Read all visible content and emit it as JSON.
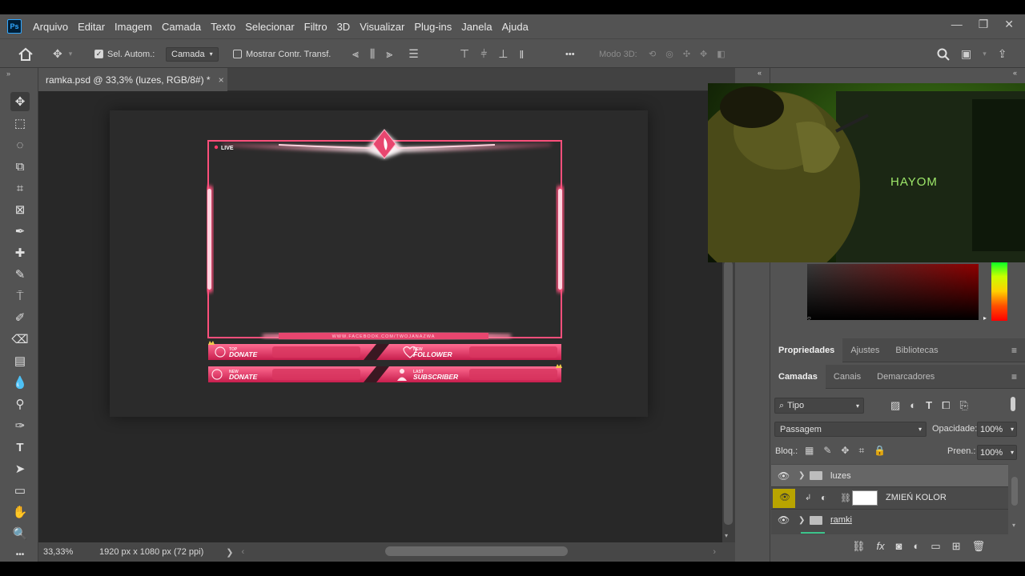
{
  "app": {
    "logo": "Ps"
  },
  "menu": [
    "Arquivo",
    "Editar",
    "Imagem",
    "Camada",
    "Texto",
    "Selecionar",
    "Filtro",
    "3D",
    "Visualizar",
    "Plug-ins",
    "Janela",
    "Ajuda"
  ],
  "window_controls": {
    "minimize": "—",
    "restore": "❐",
    "close": "✕"
  },
  "options": {
    "auto_select_label": "Sel. Autom.:",
    "auto_select_checked": true,
    "auto_select_target": "Camada",
    "show_transform_label": "Mostrar Contr. Transf.",
    "show_transform_checked": false,
    "more": "•••",
    "mode3d_label": "Modo 3D:"
  },
  "document": {
    "tab_title": "ramka.psd @ 33,3% (luzes, RGB/8#) *",
    "close": "×",
    "zoom": "33,33%",
    "dimensions": "1920 px x 1080 px (72 ppi)",
    "status_arrow": "❯"
  },
  "overlay": {
    "live": "LIVE",
    "url": "WWW.FACEBOOK.COM/TWOJANAZWA",
    "top_donate_small": "TOP",
    "top_donate": "DONATE",
    "new_follower_small": "NEW",
    "new_follower": "FOLLOWER",
    "new_donate_small": "NEW",
    "new_donate": "DONATE",
    "last_subscriber_small": "LAST",
    "last_subscriber": "SUBSCRIBER"
  },
  "webcam": {
    "monitor_brand": "HAYOM"
  },
  "properties_tabs": [
    "Propriedades",
    "Ajustes",
    "Bibliotecas"
  ],
  "layers_tabs": [
    "Camadas",
    "Canais",
    "Demarcadores"
  ],
  "layers": {
    "filter_label": "Tipo",
    "blend_mode": "Passagem",
    "opacity_label": "Opacidade:",
    "opacity_value": "100%",
    "lock_label": "Bloq.:",
    "fill_label": "Preen.:",
    "fill_value": "100%",
    "items": [
      {
        "name": "luzes",
        "type": "group",
        "visible": true,
        "selected": true
      },
      {
        "name": "ZMIEŃ KOLOR",
        "type": "adjustment",
        "visible": true,
        "selected": false
      },
      {
        "name": "ramki",
        "type": "group",
        "visible": true,
        "selected": false
      }
    ]
  },
  "colors": {
    "accent_pink": "#e8466f",
    "panel_bg": "#535353",
    "canvas_bg": "#282828"
  }
}
